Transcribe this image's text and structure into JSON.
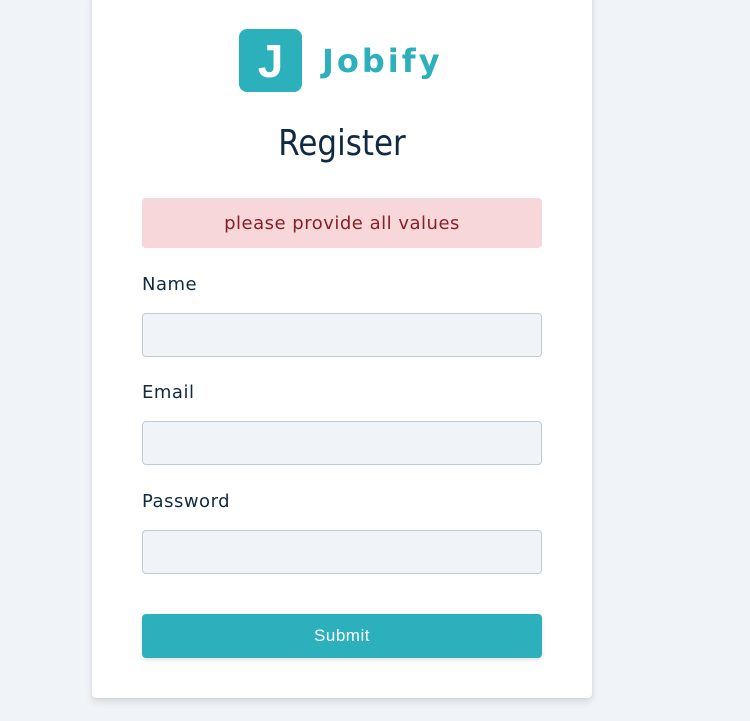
{
  "logo": {
    "mark_letter": "J",
    "brand_name": "Jobify"
  },
  "form": {
    "title": "Register",
    "alert_text": "please provide all values",
    "fields": [
      {
        "label": "Name",
        "value": "",
        "placeholder": ""
      },
      {
        "label": "Email",
        "value": "",
        "placeholder": ""
      },
      {
        "label": "Password",
        "value": "",
        "placeholder": ""
      }
    ],
    "submit_label": "Submit"
  },
  "colors": {
    "brand": "#2cb1bc",
    "background": "#f0f4f8",
    "alert_background": "#f8d7da",
    "alert_text": "#842029",
    "text_dark": "#102a43"
  }
}
